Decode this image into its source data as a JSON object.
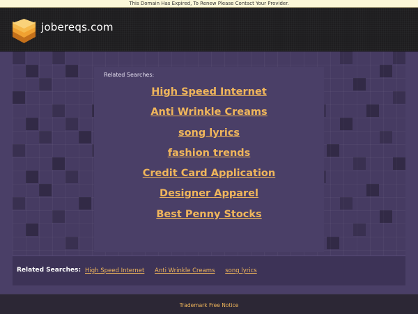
{
  "notice_bar": {
    "text": "This Domain Has Expired, To Renew Please Contact Your Provider."
  },
  "header": {
    "site_name": "jobereqs.com",
    "logo_icon": "stacked-layers-logo-icon"
  },
  "main": {
    "related_label": "Related Searches:",
    "links": [
      "High Speed Internet",
      "Anti Wrinkle Creams",
      "song lyrics",
      "fashion trends",
      "Credit Card Application",
      "Designer Apparel",
      "Best Penny Stocks"
    ]
  },
  "bottom_bar": {
    "label": "Related Searches:",
    "links": [
      "High Speed Internet",
      "Anti Wrinkle Creams",
      "song lyrics"
    ]
  },
  "footer": {
    "link": "Trademark Free Notice"
  },
  "colors": {
    "link": "#f0b65b",
    "background": "#4a3f67",
    "header": "#1e1d1f"
  }
}
